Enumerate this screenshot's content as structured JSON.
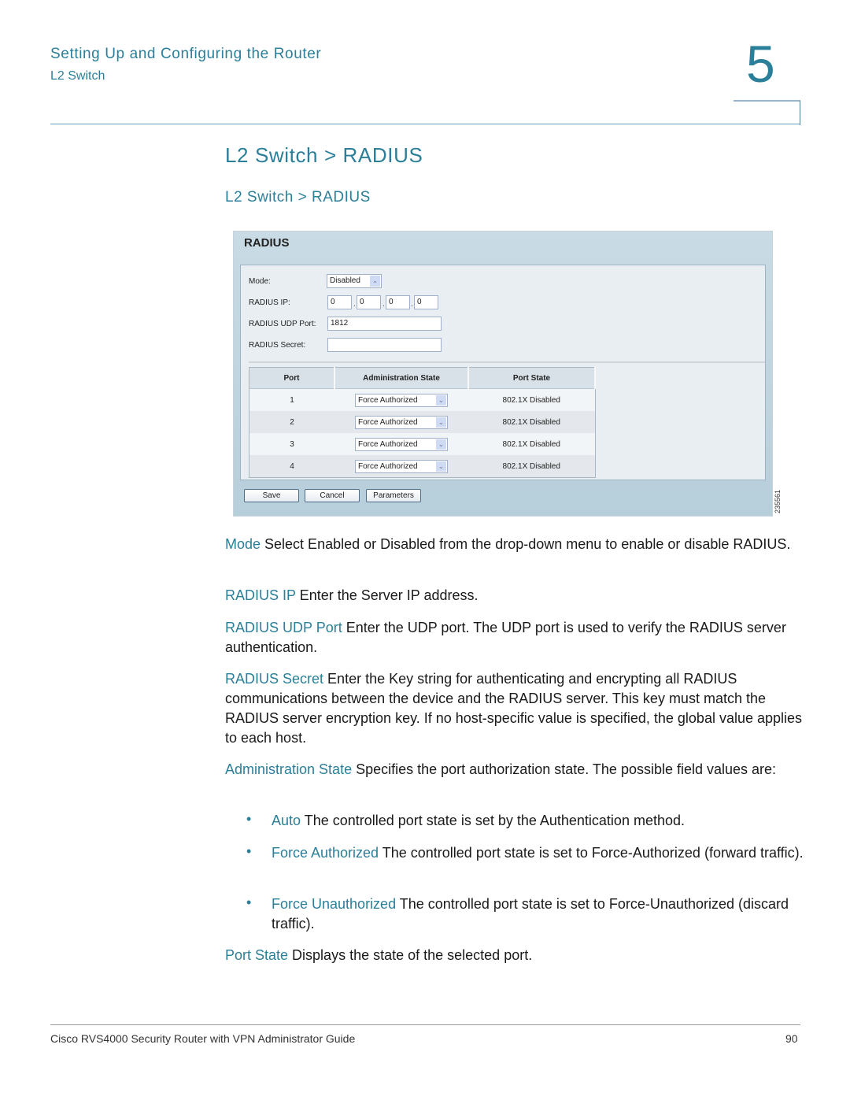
{
  "header": {
    "chapter_title": "Setting Up and Configuring the Router",
    "section": "L2 Switch",
    "chapter_number": "5"
  },
  "headings": {
    "main": "L2 Switch > RADIUS",
    "sub": "L2 Switch > RADIUS"
  },
  "screenshot": {
    "title": "RADIUS",
    "mode_label": "Mode:",
    "mode_value": "Disabled",
    "ip_label": "RADIUS IP:",
    "ip_octets": [
      "0",
      "0",
      "0",
      "0"
    ],
    "udp_label": "RADIUS UDP Port:",
    "udp_value": "1812",
    "secret_label": "RADIUS Secret:",
    "secret_value": "",
    "table": {
      "headers": [
        "Port",
        "Administration State",
        "Port State"
      ],
      "rows": [
        {
          "port": "1",
          "admin_state": "Force Authorized",
          "port_state": "802.1X Disabled"
        },
        {
          "port": "2",
          "admin_state": "Force Authorized",
          "port_state": "802.1X Disabled"
        },
        {
          "port": "3",
          "admin_state": "Force Authorized",
          "port_state": "802.1X Disabled"
        },
        {
          "port": "4",
          "admin_state": "Force Authorized",
          "port_state": "802.1X Disabled"
        }
      ]
    },
    "buttons": {
      "save": "Save",
      "cancel": "Cancel",
      "parameters": "Parameters"
    },
    "figure_number": "235561"
  },
  "descriptions": [
    {
      "term": "Mode",
      "text": " Select Enabled or Disabled from the drop-down menu to enable or disable RADIUS."
    },
    {
      "term": "RADIUS IP",
      "text": " Enter the Server IP address."
    },
    {
      "term": "RADIUS UDP Port",
      "text": " Enter the UDP port. The UDP port is used to verify the RADIUS server authentication."
    },
    {
      "term": "RADIUS Secret",
      "text": " Enter the Key string for authenticating and encrypting all RADIUS communications between the device and the RADIUS server. This key must match the RADIUS server encryption key. If no host-specific value is specified, the global value applies to each host."
    },
    {
      "term": "Administration State",
      "text": " Specifies the port authorization state. The possible field values are:"
    }
  ],
  "bullets": [
    {
      "term": "Auto",
      "text": " The controlled port state is set by the Authentication method."
    },
    {
      "term": "Force Authorized",
      "text": " The controlled port state is set to Force-Authorized (forward traffic)."
    },
    {
      "term": "Force Unauthorized",
      "text": " The controlled port state is set to Force-Unauthorized (discard traffic)."
    }
  ],
  "port_state_desc": {
    "term": "Port State",
    "text": " Displays the state of the selected port."
  },
  "footer": {
    "guide_title": "Cisco RVS4000 Security Router with VPN Administrator Guide",
    "page_number": "90"
  },
  "colors": {
    "accent": "#2b7f99"
  }
}
